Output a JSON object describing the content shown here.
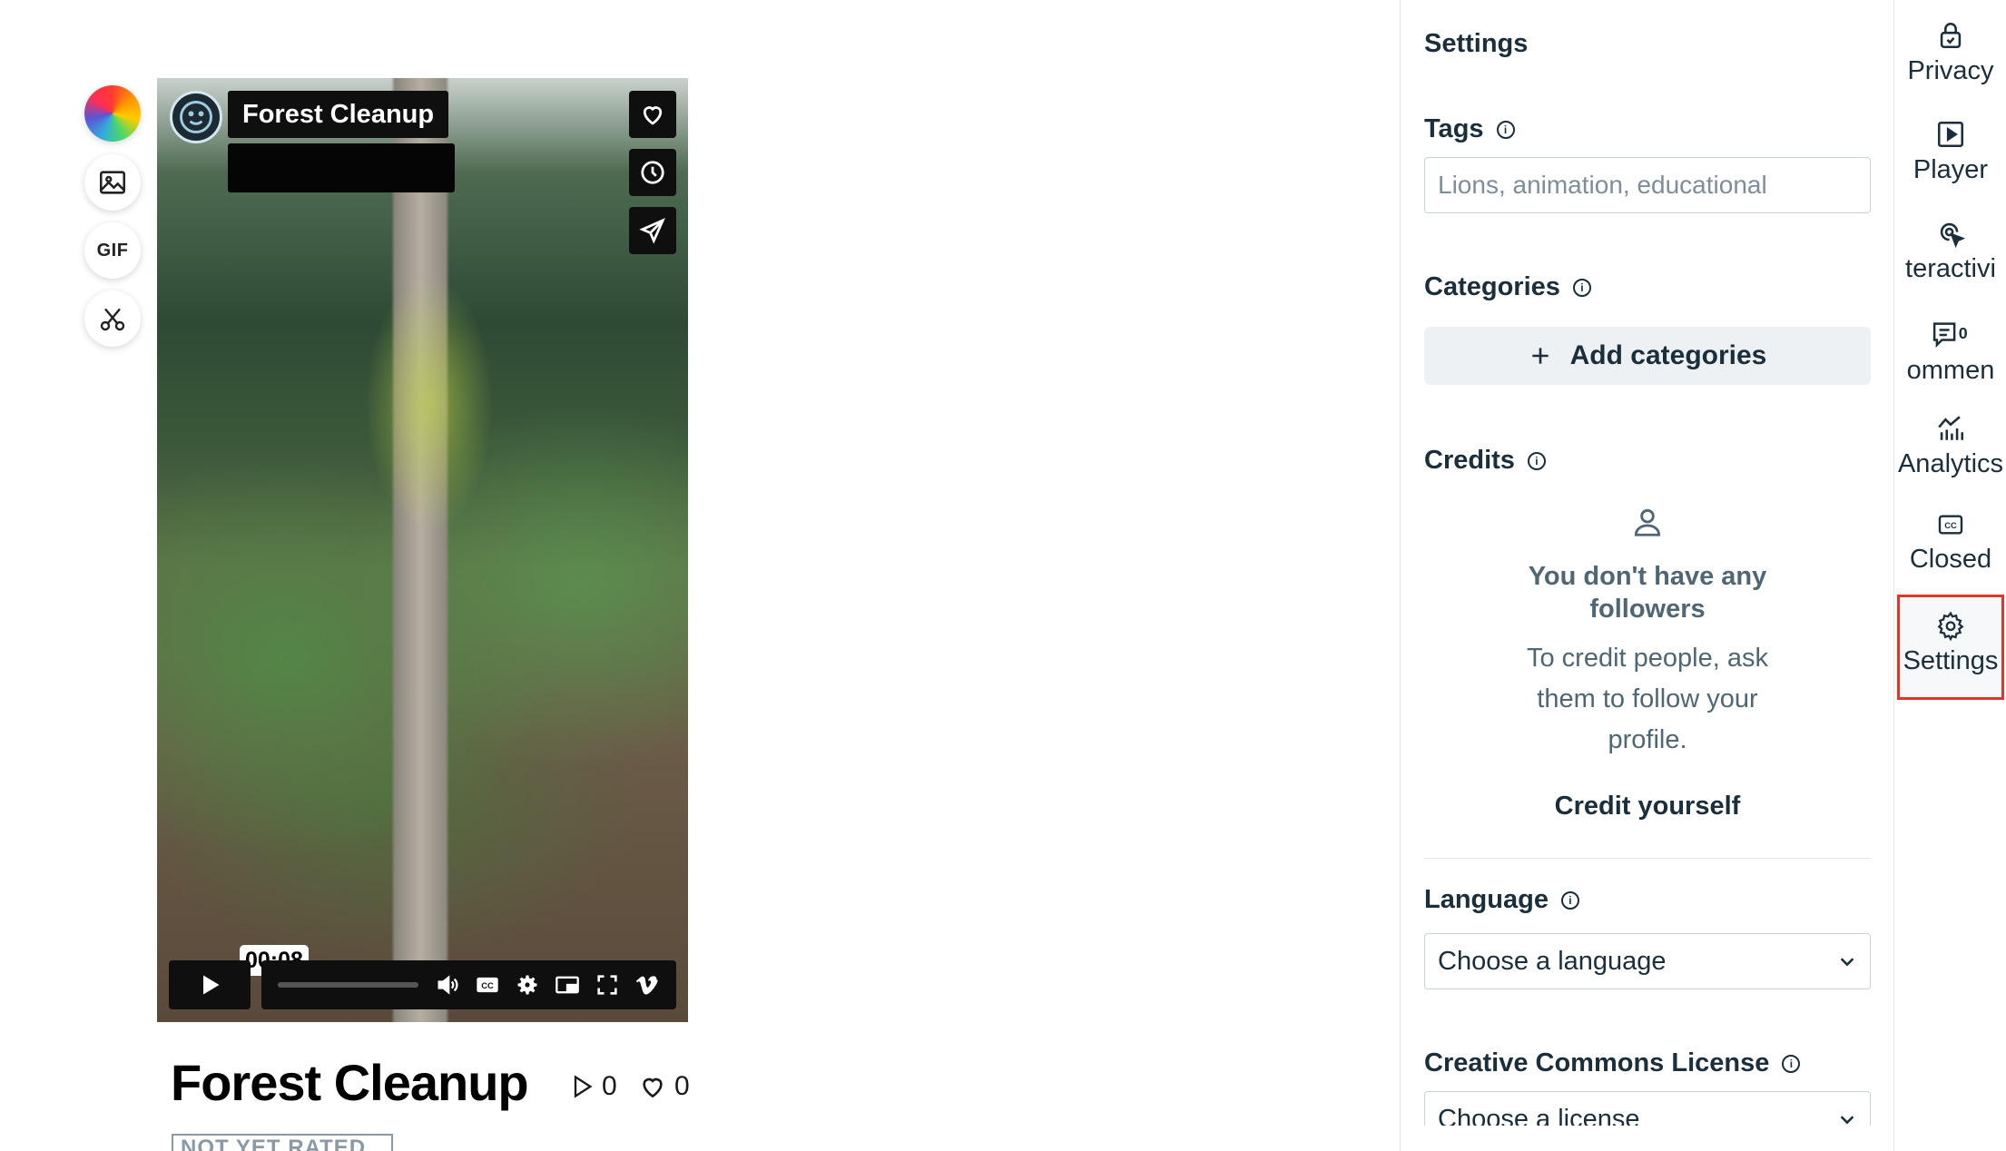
{
  "tools": {
    "gif_label": "GIF"
  },
  "video": {
    "title": "Forest Cleanup",
    "current_time": "00:08"
  },
  "page": {
    "title": "Forest Cleanup",
    "plays": "0",
    "likes": "0",
    "rating_badge": "NOT YET RATED"
  },
  "settings": {
    "title": "Settings",
    "tags_label": "Tags",
    "tags_placeholder": "Lions, animation, educational",
    "categories_label": "Categories",
    "add_categories_label": "Add categories",
    "credits_label": "Credits",
    "no_followers_title": "You don't have any followers",
    "no_followers_text": "To credit people, ask them to follow your profile.",
    "credit_yourself_label": "Credit yourself",
    "language_label": "Language",
    "language_value": "Choose a language",
    "license_label": "Creative Commons License",
    "license_value": "Choose a license"
  },
  "nav": {
    "items": [
      {
        "label": "Privacy"
      },
      {
        "label": "Player"
      },
      {
        "label": "teractivi"
      },
      {
        "label": "ommen"
      },
      {
        "label": "Analytics"
      },
      {
        "label": "Closed"
      },
      {
        "label": "Settings"
      }
    ]
  },
  "colors": {
    "accent_active": "#e0352b",
    "text_primary": "#1a2e3b",
    "text_muted": "#4f6674"
  }
}
